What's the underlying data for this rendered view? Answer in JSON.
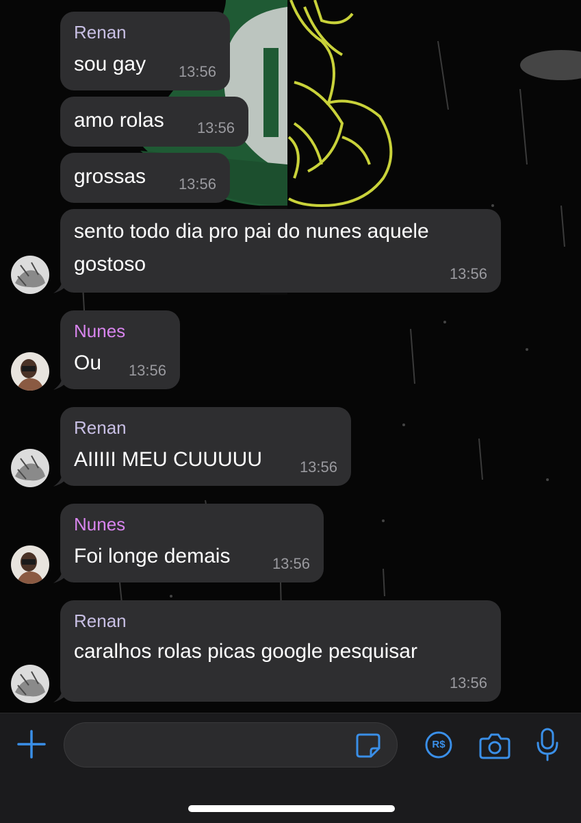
{
  "chat": {
    "messages": [
      {
        "sender": "Renan",
        "text": [
          "sou gay"
        ],
        "time": "13:56"
      },
      {
        "sender": "",
        "text": [
          "amo rolas"
        ],
        "time": "13:56"
      },
      {
        "sender": "",
        "text": [
          "grossas"
        ],
        "time": "13:56"
      },
      {
        "sender": "",
        "text": [
          "sento todo dia pro pai do nunes aquele",
          "gostoso"
        ],
        "time": "13:56"
      },
      {
        "sender": "Nunes",
        "text": [
          "Ou"
        ],
        "time": "13:56"
      },
      {
        "sender": "Renan",
        "text": [
          "AIIIII MEU CUUUUU"
        ],
        "time": "13:56"
      },
      {
        "sender": "Nunes",
        "text": [
          "Foi longe demais"
        ],
        "time": "13:56"
      },
      {
        "sender": "Renan",
        "text": [
          "caralhos rolas picas google pesquisar"
        ],
        "time": "13:56"
      }
    ]
  },
  "composer": {
    "placeholder": "",
    "payment_symbol": "R$",
    "icons": [
      "plus-icon",
      "sticker-icon",
      "payment-icon",
      "camera-icon",
      "microphone-icon"
    ]
  },
  "colors": {
    "bubble": "#2e2e30",
    "renan_name": "#c8bfe4",
    "nunes_name": "#d885ee",
    "accent_blue": "#3a8fe8",
    "timestamp": "#9a9a9f",
    "wallpaper_heart": "#c9d23a",
    "wallpaper_crest": "#1f5a34"
  }
}
